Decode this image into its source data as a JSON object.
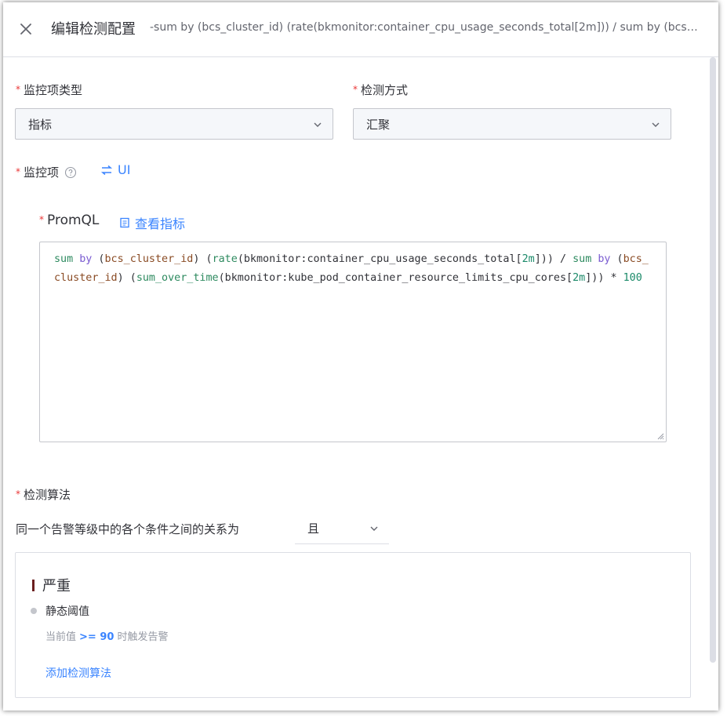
{
  "header": {
    "title": "编辑检测配置",
    "subtitle": "-sum by (bcs_cluster_id) (rate(bkmonitor:container_cpu_usage_seconds_total[2m])) / sum by (bcs_cluster_id) (sum_over_time(bkmonitor:kube_pod_container_resource_limits_cpu_cores[2m])) * 100"
  },
  "form": {
    "required_mark": "*",
    "monitor_type": {
      "label": "监控项类型",
      "value": "指标"
    },
    "detect_method": {
      "label": "检测方式",
      "value": "汇聚"
    },
    "monitor_item": {
      "label": "监控项",
      "switch_label": "UI"
    },
    "promql": {
      "label": "PromQL",
      "view_metric_label": "查看指标",
      "code": [
        {
          "t": "sum",
          "c": "fn"
        },
        {
          "t": " ",
          "c": ""
        },
        {
          "t": "by",
          "c": "kw"
        },
        {
          "t": " (",
          "c": ""
        },
        {
          "t": "bcs_cluster_id",
          "c": "lbl"
        },
        {
          "t": ") (",
          "c": ""
        },
        {
          "t": "rate",
          "c": "fn"
        },
        {
          "t": "(bkmonitor:container_cpu_usage_seconds_total[",
          "c": ""
        },
        {
          "t": "2m",
          "c": "num"
        },
        {
          "t": "])) / ",
          "c": ""
        },
        {
          "t": "sum",
          "c": "fn"
        },
        {
          "t": " ",
          "c": ""
        },
        {
          "t": "by",
          "c": "kw"
        },
        {
          "t": " (",
          "c": ""
        },
        {
          "t": "bcs_cluster_id",
          "c": "lbl"
        },
        {
          "t": ") (",
          "c": ""
        },
        {
          "t": "sum_over_time",
          "c": "fn"
        },
        {
          "t": "(bkmonitor:kube_pod_container_resource_limits_cpu_cores[",
          "c": ""
        },
        {
          "t": "2m",
          "c": "num"
        },
        {
          "t": "])) * ",
          "c": ""
        },
        {
          "t": "100",
          "c": "num"
        }
      ]
    },
    "detect_algorithm": {
      "label": "检测算法",
      "relation_label": "同一个告警等级中的各个条件之间的关系为",
      "relation_value": "且",
      "level": "严重",
      "algo_name": "静态阈值",
      "desc_prefix": "当前值",
      "operator": ">=",
      "threshold": "90",
      "desc_suffix": "时触发告警",
      "add_label": "添加检测算法"
    }
  }
}
